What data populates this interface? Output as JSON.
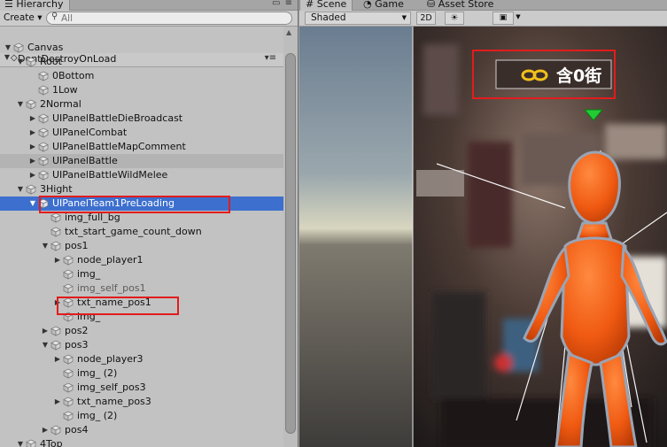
{
  "hierarchy": {
    "tab_label": "Hierarchy",
    "create_label": "Create ▾",
    "search_placeholder": "All",
    "scene_name": "DontDestroyOnLoad",
    "items": [
      {
        "label": "Canvas",
        "depth": 0,
        "arrow": "down"
      },
      {
        "label": "Root",
        "depth": 1,
        "arrow": "down"
      },
      {
        "label": "0Bottom",
        "depth": 2,
        "arrow": "none"
      },
      {
        "label": "1Low",
        "depth": 2,
        "arrow": "none"
      },
      {
        "label": "2Normal",
        "depth": 1,
        "arrow": "down"
      },
      {
        "label": "UIPanelBattleDieBroadcast",
        "depth": 2,
        "arrow": "right"
      },
      {
        "label": "UIPanelCombat",
        "depth": 2,
        "arrow": "right"
      },
      {
        "label": "UIPanelBattleMapComment",
        "depth": 2,
        "arrow": "right"
      },
      {
        "label": "UIPanelBattle",
        "depth": 2,
        "arrow": "right",
        "state": "hover"
      },
      {
        "label": "UIPanelBattleWildMelee",
        "depth": 2,
        "arrow": "right"
      },
      {
        "label": "3Hight",
        "depth": 1,
        "arrow": "down"
      },
      {
        "label": "UIPanelTeam1PreLoading",
        "depth": 2,
        "arrow": "down",
        "state": "selected"
      },
      {
        "label": "img_full_bg",
        "depth": 3,
        "arrow": "none"
      },
      {
        "label": "txt_start_game_count_down",
        "depth": 3,
        "arrow": "none"
      },
      {
        "label": "pos1",
        "depth": 3,
        "arrow": "down"
      },
      {
        "label": "node_player1",
        "depth": 4,
        "arrow": "right"
      },
      {
        "label": "img_",
        "depth": 4,
        "arrow": "none"
      },
      {
        "label": "img_self_pos1",
        "depth": 4,
        "arrow": "none",
        "state": "dim"
      },
      {
        "label": "txt_name_pos1",
        "depth": 4,
        "arrow": "right"
      },
      {
        "label": "img_",
        "depth": 4,
        "arrow": "none"
      },
      {
        "label": "pos2",
        "depth": 3,
        "arrow": "right"
      },
      {
        "label": "pos3",
        "depth": 3,
        "arrow": "down"
      },
      {
        "label": "node_player3",
        "depth": 4,
        "arrow": "right"
      },
      {
        "label": "img_ (2)",
        "depth": 4,
        "arrow": "none"
      },
      {
        "label": "img_self_pos3",
        "depth": 4,
        "arrow": "none"
      },
      {
        "label": "txt_name_pos3",
        "depth": 4,
        "arrow": "right"
      },
      {
        "label": "img_ (2)",
        "depth": 4,
        "arrow": "none"
      },
      {
        "label": "pos4",
        "depth": 3,
        "arrow": "right"
      },
      {
        "label": "4Top",
        "depth": 1,
        "arrow": "down"
      }
    ]
  },
  "scene": {
    "tabs": [
      {
        "label": "Scene",
        "icon": "grid-icon",
        "active": true
      },
      {
        "label": "Game",
        "icon": "pacman-icon",
        "active": false
      },
      {
        "label": "Asset Store",
        "icon": "store-icon",
        "active": false
      }
    ],
    "shading_mode": "Shaded",
    "mode_2d_label": "2D",
    "banner_text": "含0街"
  },
  "colors": {
    "selection": "#3d6fce",
    "highlight_box": "#e21c1c",
    "character": "#f05a12",
    "marker": "#22cc33"
  }
}
